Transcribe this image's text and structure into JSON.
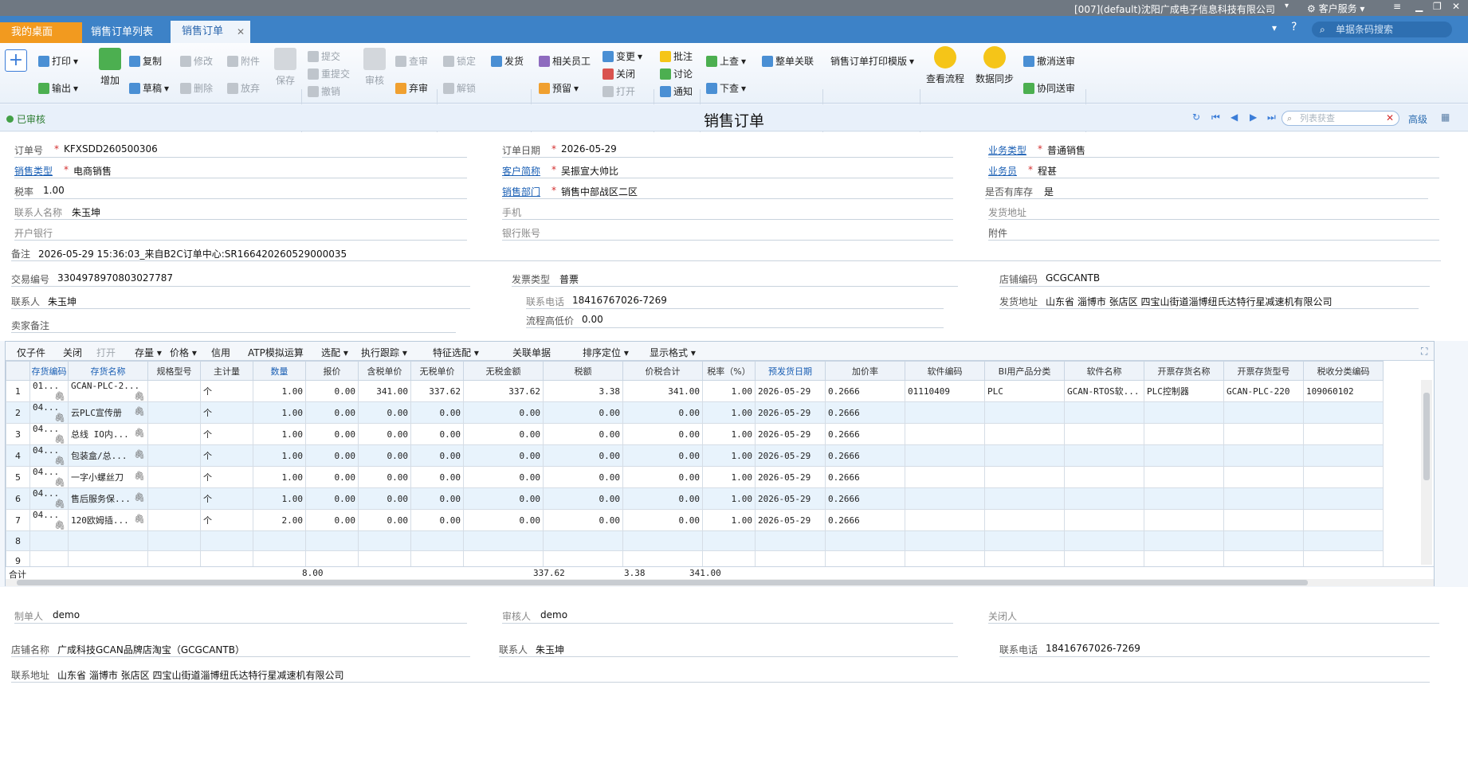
{
  "topbar": {
    "company": "[007](default)沈阳广成电子信息科技有限公司",
    "service": "客户服务"
  },
  "tabs": {
    "desktop": "我的桌面",
    "order_list": "销售订单列表",
    "order": "销售订单",
    "barcode_search": "单据条码搜索"
  },
  "ribbon": {
    "print": "打印",
    "export": "输出",
    "add": "增加",
    "copy": "复制",
    "draft": "草稿",
    "modify": "修改",
    "delete": "删除",
    "attachment": "附件",
    "discard": "放弃",
    "save": "保存",
    "submit": "提交",
    "resubmit": "重提交",
    "revoke": "撤销",
    "review": "审核",
    "check": "查审",
    "abandon": "弃审",
    "lock": "锁定",
    "unlock": "解锁",
    "ship": "发货",
    "related_staff": "相关员工",
    "reserve": "预留",
    "change": "变更",
    "close": "关闭",
    "open": "打开",
    "annotate": "批注",
    "discuss": "讨论",
    "notify": "通知",
    "prev_search": "上查",
    "next_search": "下查",
    "whole_link": "整单关联",
    "print_template": "销售订单打印模版",
    "view_flow": "查看流程",
    "data_sync": "数据同步",
    "revoke_delivery": "撤消送审",
    "cowork_delivery": "协同送审"
  },
  "titlebar": {
    "status": "已审核",
    "title": "销售订单",
    "search_placeholder": "列表获查",
    "advanced": "高级"
  },
  "form": {
    "order_no_label": "订单号",
    "order_no": "KFXSDD260500306",
    "order_date_label": "订单日期",
    "order_date": "2026-05-29",
    "biz_type_label": "业务类型",
    "biz_type": "普通销售",
    "sale_type_label": "销售类型",
    "sale_type": "电商销售",
    "customer_label": "客户简称",
    "customer": "吴振宣大帅比",
    "salesman_label": "业务员",
    "salesman": "程甚",
    "tax_rate_label": "税率",
    "tax_rate": "1.00",
    "dept_label": "销售部门",
    "dept": "销售中部战区二区",
    "in_stock_label": "是否有库存",
    "in_stock": "是",
    "contact_label": "联系人名称",
    "contact": "朱玉坤",
    "mobile_label": "手机",
    "ship_addr_label": "发货地址",
    "bank_label": "开户银行",
    "bank_acct_label": "银行账号",
    "attach_label": "附件",
    "remark_label": "备注",
    "remark": "2026-05-29 15:36:03_来自B2C订单中心:SR166420260529000035",
    "trade_no_label": "交易编号",
    "trade_no": "3304978970803027787",
    "invoice_type_label": "发票类型",
    "invoice_type": "普票",
    "shop_code_label": "店铺编码",
    "shop_code": "GCGCANTB",
    "contact2_label": "联系人",
    "contact2": "朱玉坤",
    "phone_label": "联系电话",
    "phone": "18416767026-7269",
    "ship_addr2_label": "发货地址",
    "ship_addr2": "山东省 淄博市 张店区 四宝山街道淄博纽氏达特行星减速机有限公司",
    "seller_note_label": "卖家备注",
    "low_price_label": "流程高低价",
    "low_price": "0.00"
  },
  "grid_toolbar": [
    "仅子件",
    "关闭",
    "打开",
    "存量",
    "价格",
    "信用",
    "ATP模拟运算",
    "选配",
    "执行跟踪",
    "特征选配",
    "关联单据",
    "排序定位",
    "显示格式"
  ],
  "grid": {
    "headers": [
      "存货编码",
      "存货名称",
      "规格型号",
      "主计量",
      "数量",
      "报价",
      "含税单价",
      "无税单价",
      "无税金额",
      "税额",
      "价税合计",
      "税率（%）",
      "预发货日期",
      "加价率",
      "软件编码",
      "BI用产品分类",
      "软件名称",
      "开票存货名称",
      "开票存货型号",
      "税收分类编码"
    ],
    "rows": [
      [
        "1",
        "01...",
        "GCAN-PLC-2...",
        "",
        "个",
        "1.00",
        "0.00",
        "341.00",
        "337.62",
        "337.62",
        "3.38",
        "341.00",
        "1.00",
        "2026-05-29",
        "0.2666",
        "01110409",
        "PLC",
        "GCAN-RTOS软...",
        "PLC控制器",
        "GCAN-PLC-220",
        "109060102"
      ],
      [
        "2",
        "04...",
        "云PLC宣传册",
        "",
        "个",
        "1.00",
        "0.00",
        "0.00",
        "0.00",
        "0.00",
        "0.00",
        "0.00",
        "1.00",
        "2026-05-29",
        "0.2666",
        "",
        "",
        "",
        "",
        "",
        ""
      ],
      [
        "3",
        "04...",
        "总线 IO内...",
        "",
        "个",
        "1.00",
        "0.00",
        "0.00",
        "0.00",
        "0.00",
        "0.00",
        "0.00",
        "1.00",
        "2026-05-29",
        "0.2666",
        "",
        "",
        "",
        "",
        "",
        ""
      ],
      [
        "4",
        "04...",
        "包装盒/总...",
        "",
        "个",
        "1.00",
        "0.00",
        "0.00",
        "0.00",
        "0.00",
        "0.00",
        "0.00",
        "1.00",
        "2026-05-29",
        "0.2666",
        "",
        "",
        "",
        "",
        "",
        ""
      ],
      [
        "5",
        "04...",
        "一字小螺丝刀",
        "",
        "个",
        "1.00",
        "0.00",
        "0.00",
        "0.00",
        "0.00",
        "0.00",
        "0.00",
        "1.00",
        "2026-05-29",
        "0.2666",
        "",
        "",
        "",
        "",
        "",
        ""
      ],
      [
        "6",
        "04...",
        "售后服务保...",
        "",
        "个",
        "1.00",
        "0.00",
        "0.00",
        "0.00",
        "0.00",
        "0.00",
        "0.00",
        "1.00",
        "2026-05-29",
        "0.2666",
        "",
        "",
        "",
        "",
        "",
        ""
      ],
      [
        "7",
        "04...",
        "120欧姆插...",
        "",
        "个",
        "2.00",
        "0.00",
        "0.00",
        "0.00",
        "0.00",
        "0.00",
        "0.00",
        "1.00",
        "2026-05-29",
        "0.2666",
        "",
        "",
        "",
        "",
        "",
        ""
      ],
      [
        "8",
        "",
        "",
        "",
        "",
        "",
        "",
        "",
        "",
        "",
        "",
        "",
        "",
        "",
        "",
        "",
        "",
        "",
        "",
        "",
        ""
      ],
      [
        "9",
        "",
        "",
        "",
        "",
        "",
        "",
        "",
        "",
        "",
        "",
        "",
        "",
        "",
        "",
        "",
        "",
        "",
        "",
        "",
        ""
      ]
    ],
    "sum_label": "合计",
    "sum_qty": "8.00",
    "sum_amount": "337.62",
    "sum_tax": "3.38",
    "sum_total": "341.00"
  },
  "footer": {
    "maker_label": "制单人",
    "maker": "demo",
    "auditor_label": "审核人",
    "auditor": "demo",
    "closer_label": "关闭人",
    "shop_name_label": "店铺名称",
    "shop_name": "广成科技GCAN品牌店淘宝（GCGCANTB）",
    "contact_label": "联系人",
    "contact": "朱玉坤",
    "phone_label": "联系电话",
    "phone": "18416767026-7269",
    "addr_label": "联系地址",
    "addr": "山东省 淄博市 张店区 四宝山街道淄博纽氏达特行星减速机有限公司"
  }
}
